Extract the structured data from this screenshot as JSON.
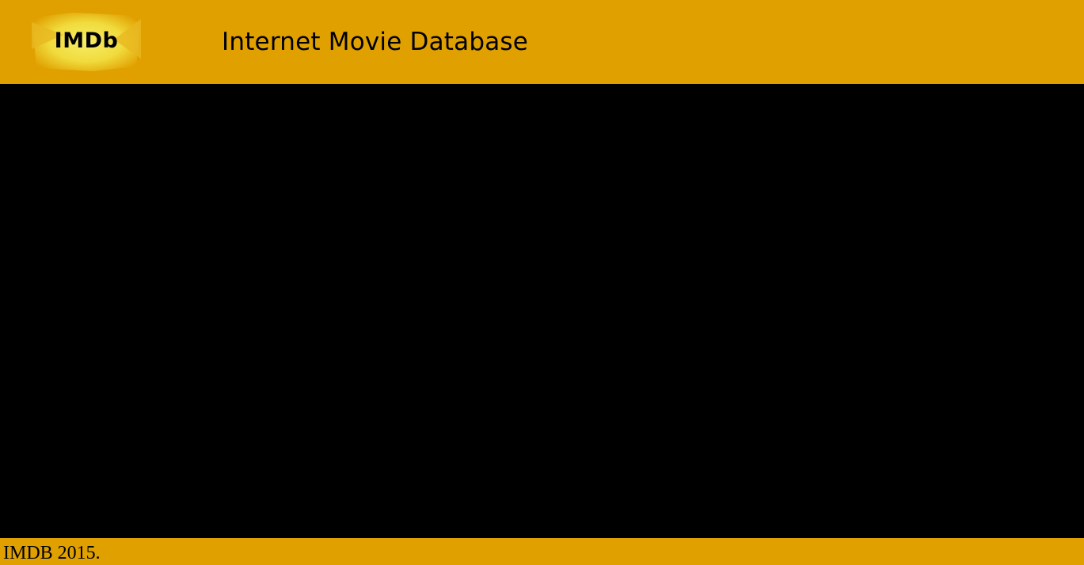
{
  "header": {
    "logo_text": "IMDb",
    "title": "Internet Movie Database"
  },
  "footer": {
    "copyright": "IMDB 2015."
  },
  "colors": {
    "brand": "#e0a000",
    "logo_fill": "#f3e04a",
    "content_bg": "#000000"
  }
}
